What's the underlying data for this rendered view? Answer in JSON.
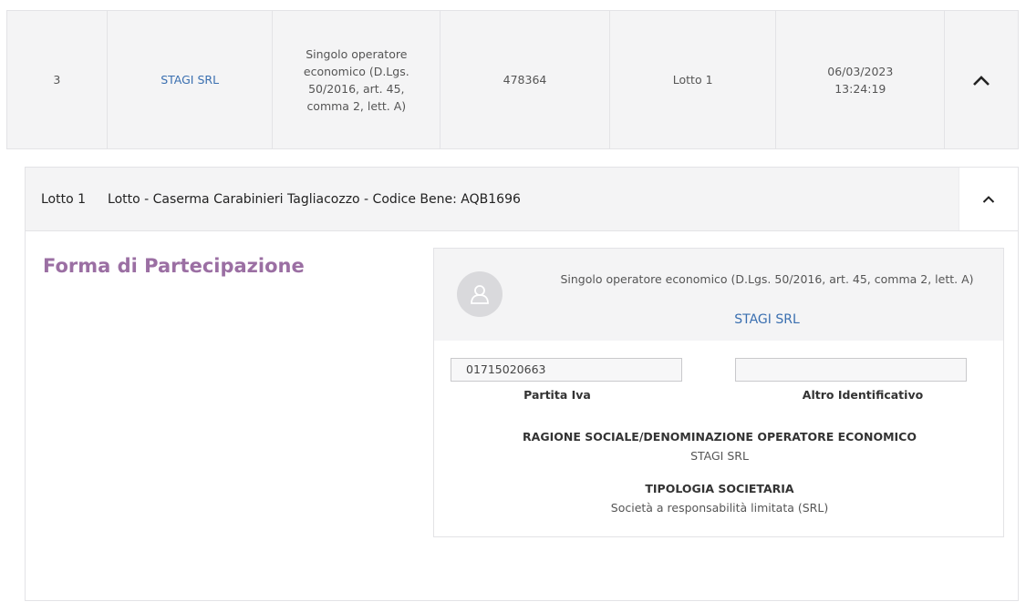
{
  "summary": {
    "number": "3",
    "operator_name": "STAGI SRL",
    "participation_type": "Singolo operatore economico (D.Lgs. 50/2016, art. 45, comma 2, lett. A)",
    "code": "478364",
    "lot": "Lotto 1",
    "date": "06/03/2023",
    "time": "13:24:19",
    "toggle_icon": "chevron-up-icon"
  },
  "lot_panel": {
    "label": "Lotto 1",
    "title": "Lotto - Caserma Carabinieri Tagliacozzo - Codice Bene: AQB1696",
    "toggle_icon": "chevron-up-icon",
    "section_title": "Forma di Partecipazione"
  },
  "operator_card": {
    "avatar_icon": "user-avatar-icon",
    "participation_type": "Singolo operatore economico (D.Lgs. 50/2016, art. 45, comma 2, lett. A)",
    "name": "STAGI SRL",
    "partita_iva_value": "01715020663",
    "partita_iva_label": "Partita Iva",
    "altro_identificativo_value": "",
    "altro_identificativo_label": "Altro Identificativo",
    "ragione_sociale_title": "RAGIONE SOCIALE/DENOMINAZIONE OPERATORE ECONOMICO",
    "ragione_sociale_value": "STAGI SRL",
    "tipologia_title": "TIPOLOGIA SOCIETARIA",
    "tipologia_value": "Società a responsabilità limitata (SRL)"
  },
  "colors": {
    "accent_link": "#3a6fb0",
    "section_title": "#9b6fa3",
    "panel_bg": "#f4f4f5"
  }
}
